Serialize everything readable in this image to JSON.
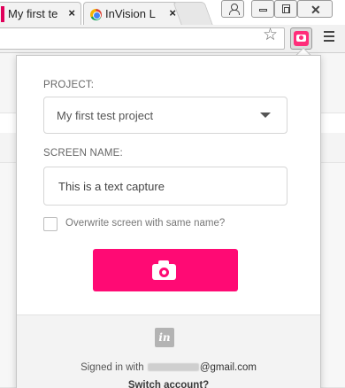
{
  "browser": {
    "tabs": [
      {
        "title": "My first te",
        "close": "×"
      },
      {
        "title": "InVision L",
        "close": "×"
      }
    ],
    "star": "☆"
  },
  "popup": {
    "project_label": "PROJECT:",
    "project_value": "My first test project",
    "screen_name_label": "SCREEN NAME:",
    "screen_name_value": "This is a text capture",
    "overwrite_label": "Overwrite screen with same name?",
    "overwrite_checked": false,
    "capture_button": "camera-icon",
    "accent_color": "#ff0a74"
  },
  "footer": {
    "logo": "in",
    "signed_in_prefix": "Signed in with ",
    "signed_in_domain": "@gmail.com",
    "switch_account": "Switch account?"
  }
}
